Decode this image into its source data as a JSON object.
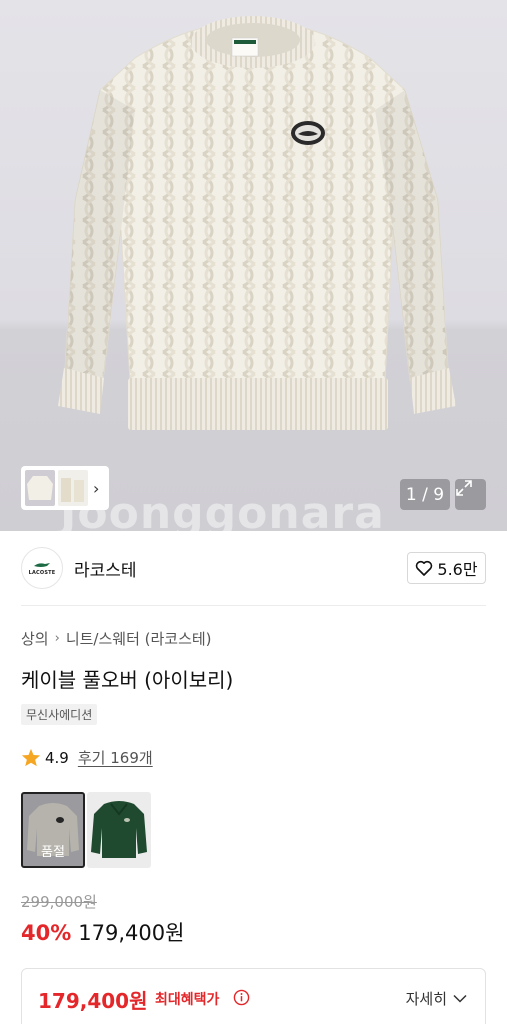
{
  "gallery": {
    "current": 1,
    "total": 9,
    "counter_text": "1 / 9",
    "watermark": "Joonggonara"
  },
  "brand": {
    "name": "라코스테",
    "logo_text": "LACOSTE",
    "likes": "5.6만"
  },
  "product": {
    "breadcrumb": [
      "상의",
      "니트/스웨터 (라코스테)"
    ],
    "title": "케이블 풀오버 (아이보리)",
    "tag": "무신사에디션",
    "rating": "4.9",
    "reviews_label": "후기 169개",
    "variants": [
      {
        "color": "아이보리",
        "status": "품절",
        "selected": true
      },
      {
        "color": "그린",
        "status": "",
        "selected": false
      }
    ]
  },
  "price": {
    "original": "299,000원",
    "discount": "40%",
    "sale": "179,400원"
  },
  "benefit": {
    "price": "179,400원",
    "label": "최대혜택가",
    "detail": "자세히"
  },
  "colors": {
    "accent_red": "#e4272a",
    "sweater": "#f2efe6",
    "background": "#dddce2"
  }
}
